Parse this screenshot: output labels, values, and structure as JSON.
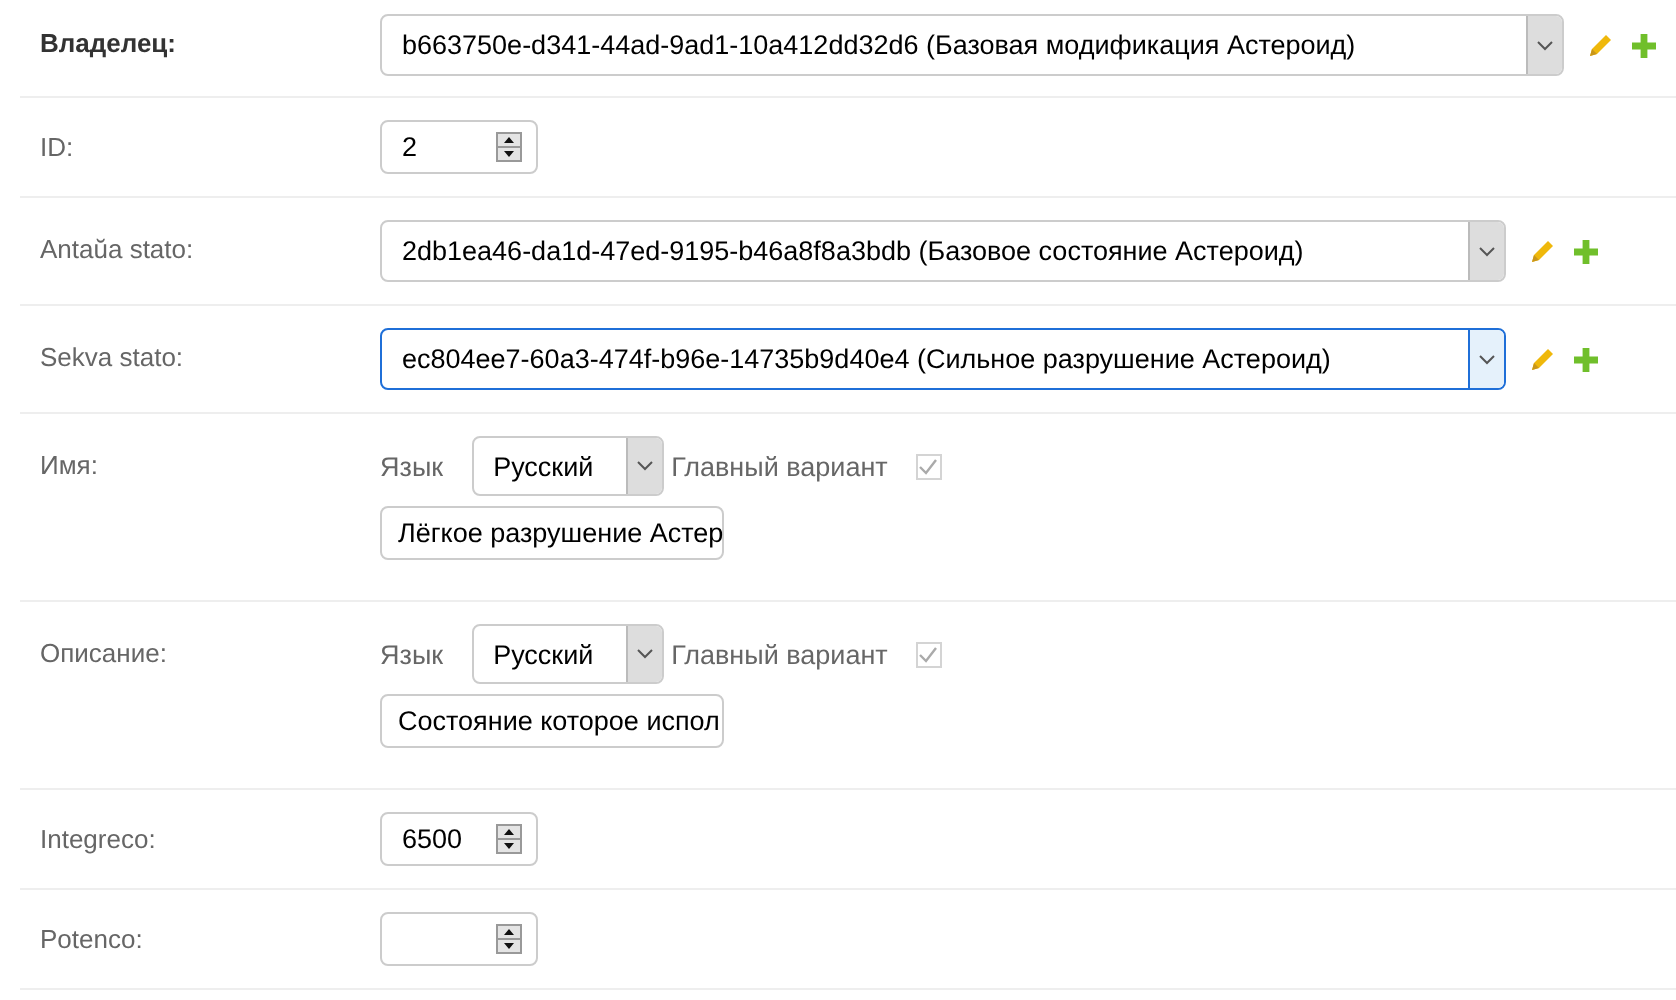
{
  "fields": [
    {
      "kind": "select",
      "label": "Владелец:",
      "required": true,
      "value": "b663750e-d341-44ad-9ad1-10a412dd32d6 (Базовая модификация Астероид)",
      "wide": true,
      "focused": false
    },
    {
      "kind": "number",
      "label": "ID:",
      "required": false,
      "value": "2"
    },
    {
      "kind": "select",
      "label": "Antaŭa stato:",
      "required": false,
      "value": "2db1ea46-da1d-47ed-9195-b46a8f8a3bdb (Базовое состояние Астероид)",
      "wide": false,
      "focused": false
    },
    {
      "kind": "select",
      "label": "Sekva stato:",
      "required": false,
      "value": "ec804ee7-60a3-474f-b96e-14735b9d40e4 (Сильное разрушение Астероид)",
      "wide": false,
      "focused": true
    },
    {
      "kind": "translation",
      "label": "Имя:",
      "required": false,
      "language_label": "Язык",
      "language": "Русский",
      "main_label": "Главный вариант",
      "main_checked": true,
      "main_disabled": true,
      "value": "Лёгкое разрушение Астер"
    },
    {
      "kind": "translation",
      "label": "Описание:",
      "required": false,
      "language_label": "Язык",
      "language": "Русский",
      "main_label": "Главный вариант",
      "main_checked": true,
      "main_disabled": true,
      "value": "Состояние которое испол"
    },
    {
      "kind": "number",
      "label": "Integreco:",
      "required": false,
      "value": "6500"
    },
    {
      "kind": "number",
      "label": "Potenco:",
      "required": false
    }
  ]
}
